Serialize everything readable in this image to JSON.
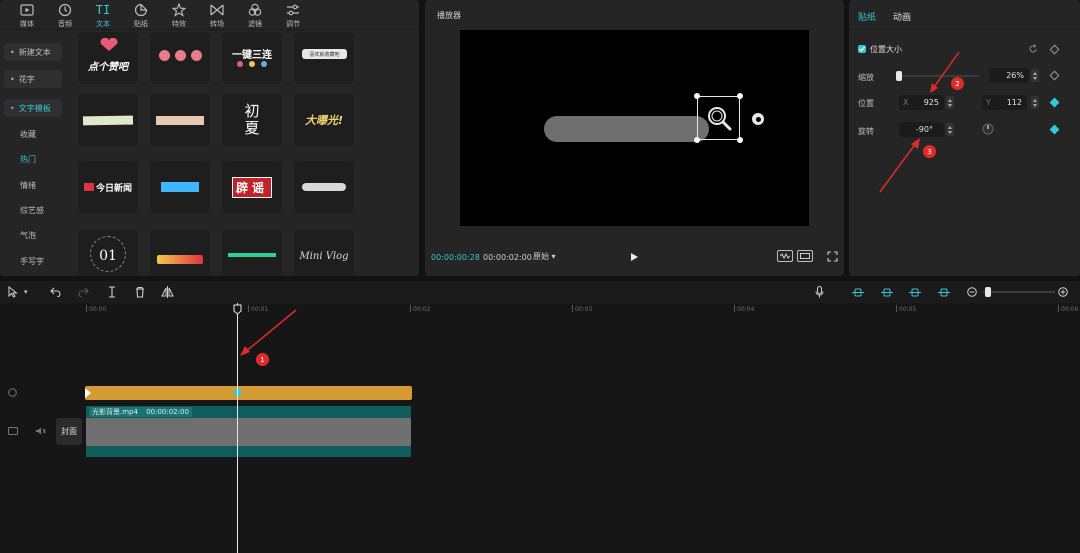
{
  "toolbar_tabs": [
    {
      "label": "媒体",
      "icon": "media-icon"
    },
    {
      "label": "音频",
      "icon": "audio-icon"
    },
    {
      "label": "文本",
      "icon": "text-icon",
      "glyph": "TI"
    },
    {
      "label": "贴纸",
      "icon": "sticker-icon"
    },
    {
      "label": "特效",
      "icon": "effects-icon"
    },
    {
      "label": "转场",
      "icon": "transition-icon"
    },
    {
      "label": "滤镜",
      "icon": "filter-icon"
    },
    {
      "label": "调节",
      "icon": "adjust-icon"
    }
  ],
  "text_side_menu": [
    {
      "label": "新建文本",
      "prefix": "•"
    },
    {
      "label": "花字",
      "prefix": "•"
    },
    {
      "label": "文字模板",
      "prefix": "•"
    },
    {
      "label": "收藏"
    },
    {
      "label": "热门"
    },
    {
      "label": "情绪"
    },
    {
      "label": "综艺感"
    },
    {
      "label": "气泡"
    },
    {
      "label": "手写字"
    }
  ],
  "templates": [
    {
      "text": "点个赞吧",
      "color": "#ffffff"
    },
    {
      "text": "",
      "color": "#ffffff"
    },
    {
      "text": "一键三连",
      "color": "#ffffff"
    },
    {
      "text": "喜欢就收藏吧",
      "color": "#333333"
    },
    {
      "text": "",
      "color": "#ffffff"
    },
    {
      "text": "",
      "color": "#ffffff"
    },
    {
      "text": "初夏",
      "color": "#ffffff"
    },
    {
      "text": "大曝光!",
      "color": "#f2d36b"
    },
    {
      "text": "今日新闻",
      "color": "#ffffff"
    },
    {
      "text": "",
      "color": "#3fb6ff"
    },
    {
      "text": "辟谣",
      "color": "#ffffff"
    },
    {
      "text": "",
      "color": "#ffffff"
    },
    {
      "text": "01",
      "color": "#ffffff"
    },
    {
      "text": "",
      "color": "#ffffff"
    },
    {
      "text": "",
      "color": "#ffffff"
    },
    {
      "text": "Mini Vlog",
      "color": "#d9d9d9"
    }
  ],
  "player": {
    "title": "播放器",
    "time_current": "00:00:00:28",
    "time_total": "00:00:02:00",
    "ratio": "原始"
  },
  "props": {
    "tab_sticker": "贴纸",
    "tab_animation": "动画",
    "section_label": "位置大小",
    "scale_label": "缩放",
    "scale_value": "26%",
    "position_label": "位置",
    "pos_x_label": "X",
    "pos_x_value": "925",
    "pos_y_label": "Y",
    "pos_y_value": "112",
    "rotate_label": "旋转",
    "rotate_value": "-90°"
  },
  "annotations": [
    {
      "number": "1"
    },
    {
      "number": "2"
    },
    {
      "number": "3"
    }
  ],
  "timeline": {
    "ticks": [
      "00:00",
      "00:01",
      "00:02",
      "00:03",
      "00:04",
      "00:05",
      "00:06"
    ],
    "video_clip_label": "光影背景.mp4",
    "video_clip_duration": "00:00:02:00",
    "cover_label": "封面"
  },
  "colors": {
    "accent": "#36c7d6",
    "sticker_clip": "#d69a33",
    "video_track": "#0f5c5c",
    "annotation": "#e02b2b"
  }
}
